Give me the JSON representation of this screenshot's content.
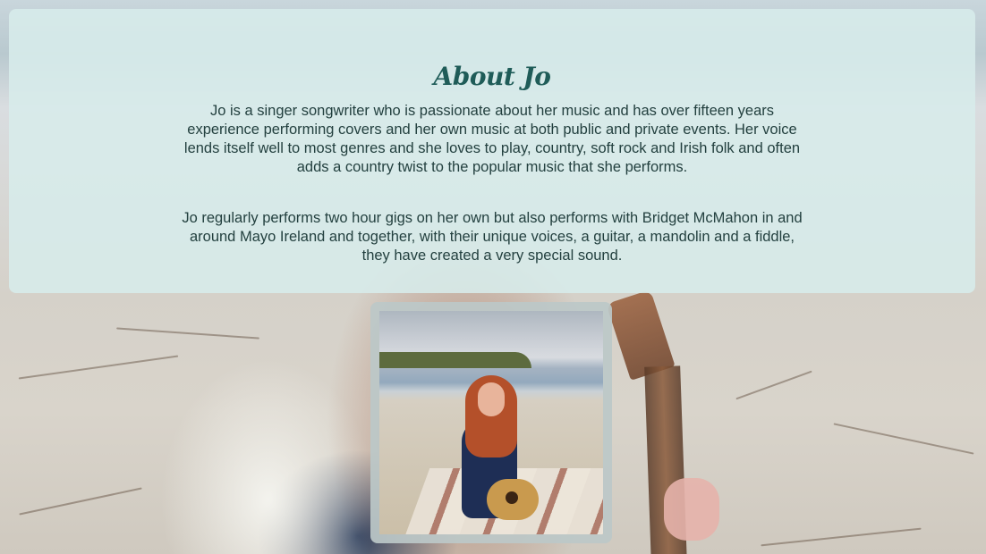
{
  "about": {
    "title": "About Jo",
    "paragraphs": [
      "Jo is a singer songwriter who is passionate about her music and has over fifteen years experience performing covers and her own music at both public and private events. Her voice lends itself well to most genres and she loves to play, country, soft rock and Irish folk and often adds a country twist to the popular music that she performs.",
      "Jo regularly performs two hour gigs on her own but also performs with Bridget McMahon in and around Mayo Ireland and together, with their unique voices, a guitar, a mandolin and a fiddle, they have created a very special sound."
    ]
  },
  "colors": {
    "panel_background": "#d7ecea",
    "title_color": "#1f5c58",
    "text_color": "#23403f"
  }
}
